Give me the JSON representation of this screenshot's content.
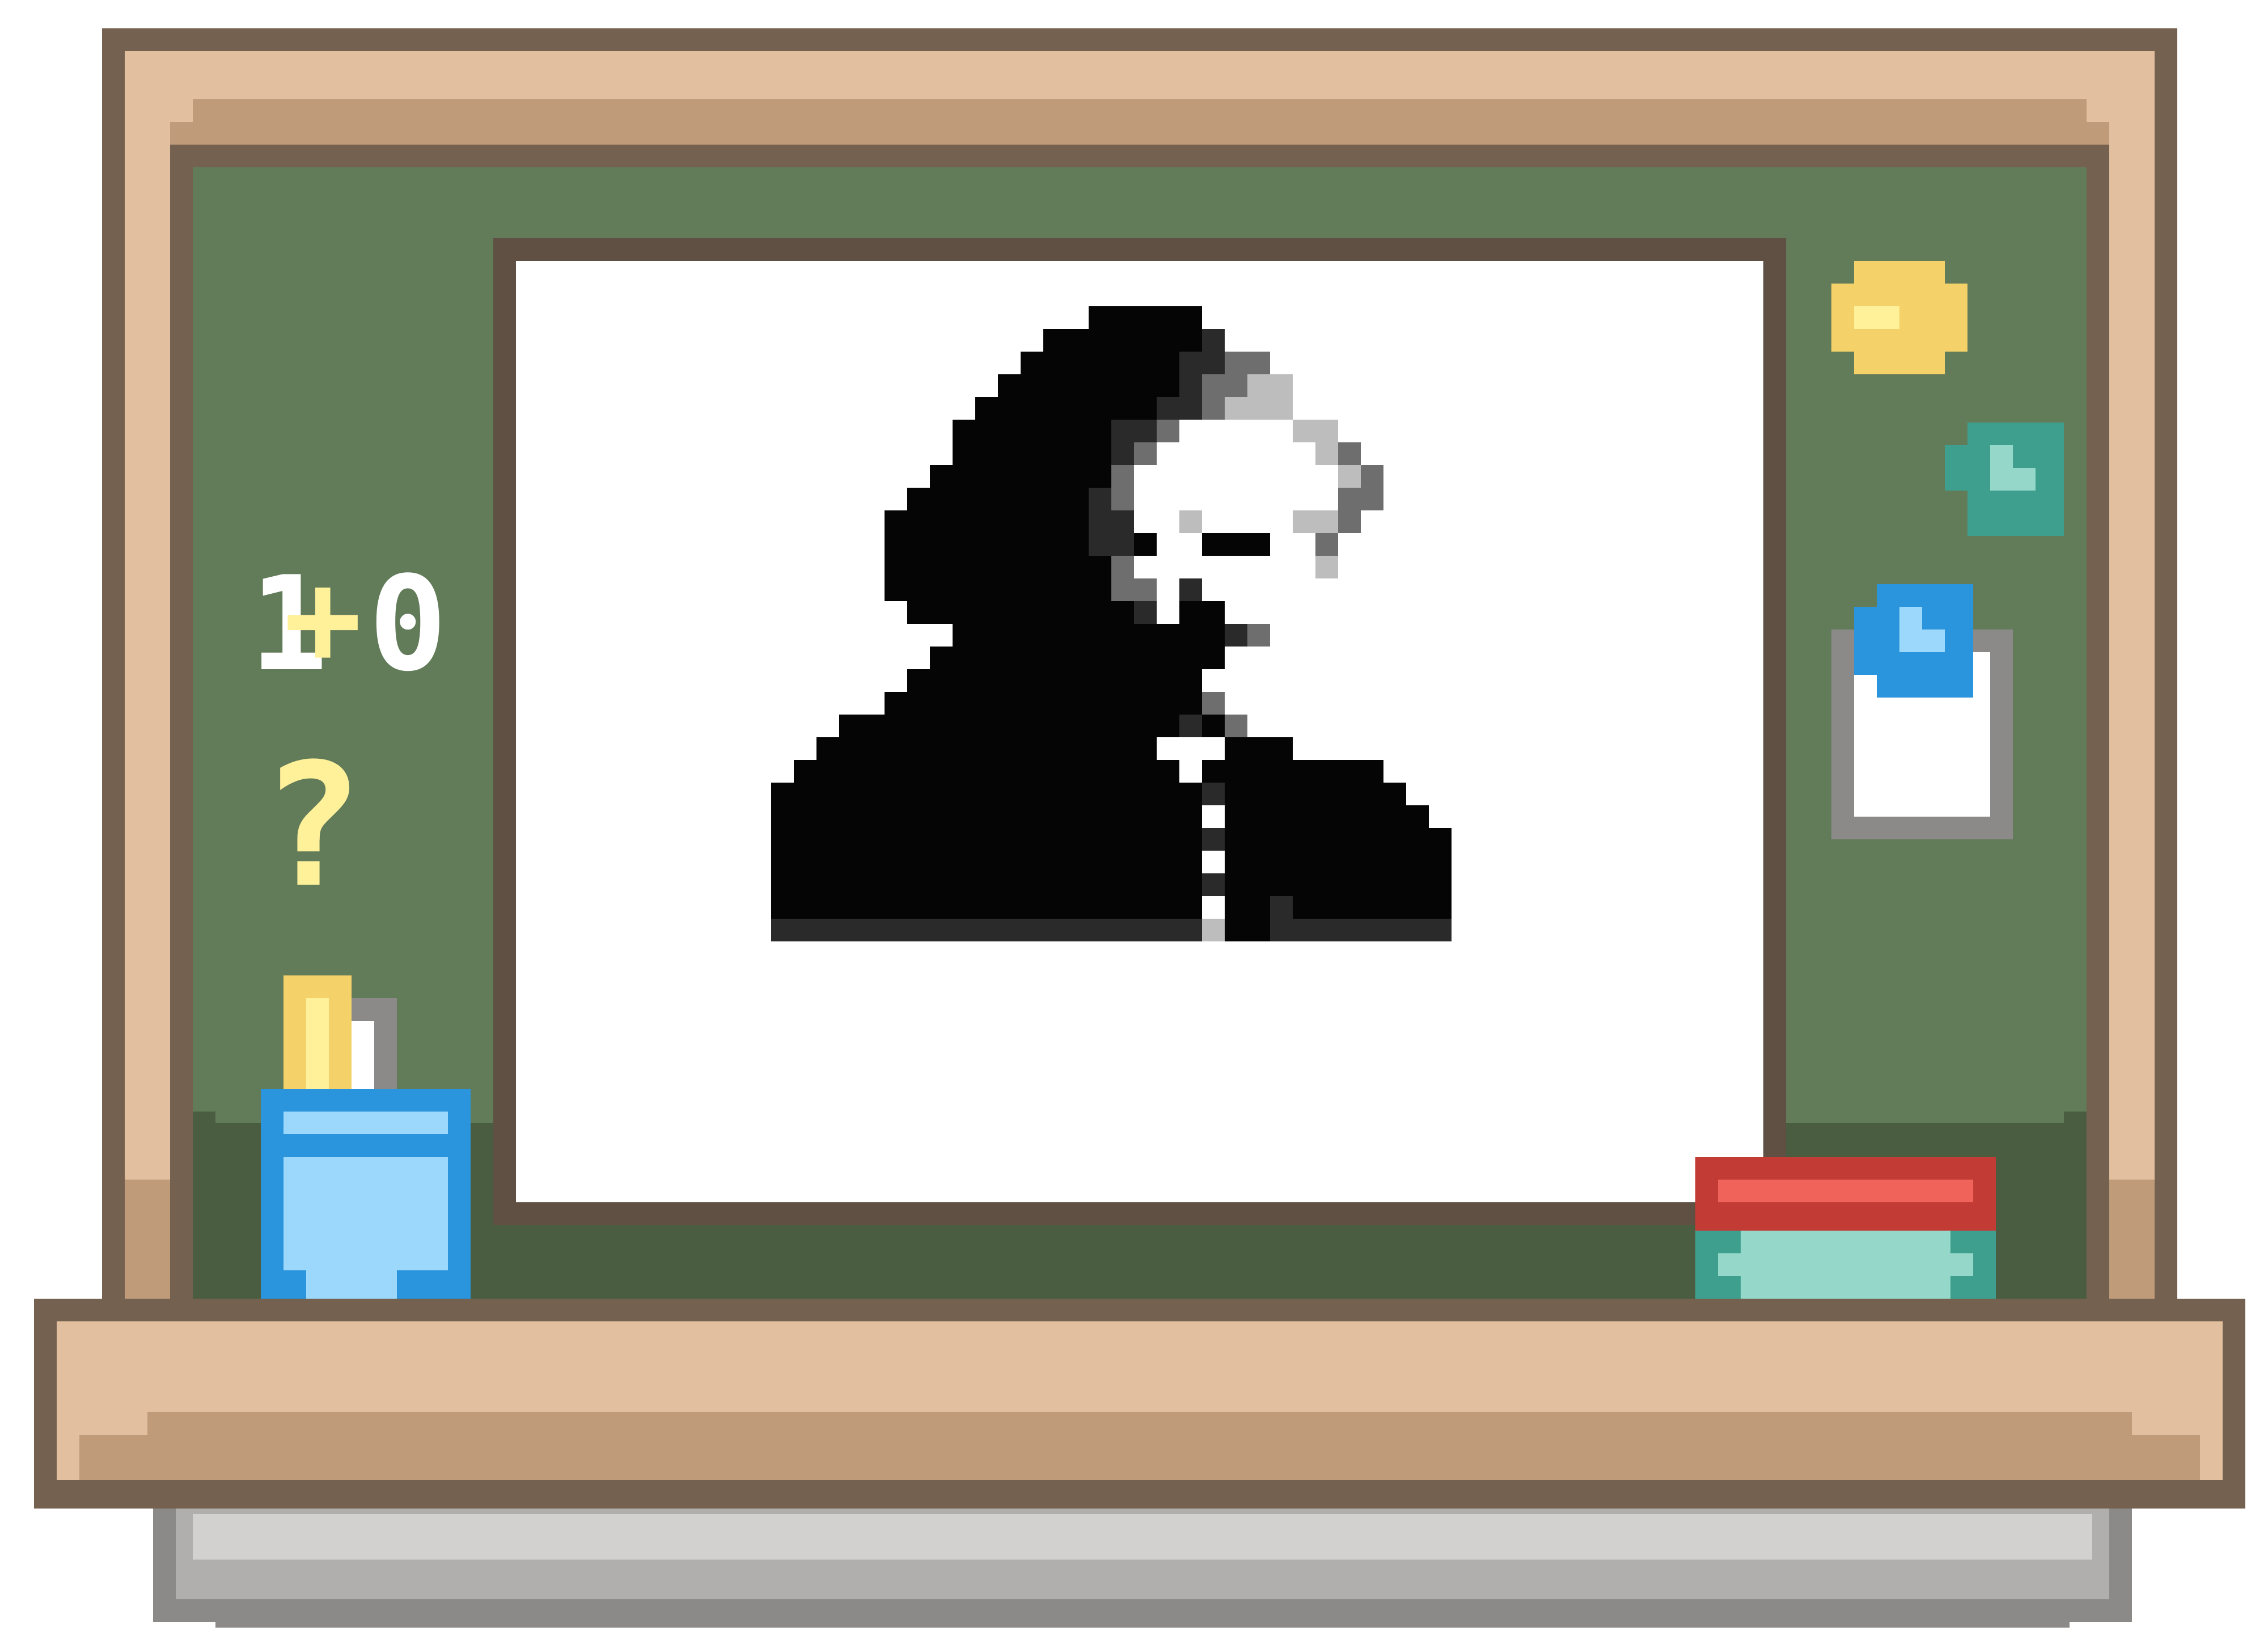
{
  "scene": {
    "chalk_equation": {
      "left": "1",
      "operator": "+",
      "right": "0"
    },
    "chalk_question": "?"
  },
  "colors": {
    "frame_light": "#e2c09f",
    "frame_mid": "#bf9b79",
    "frame_dark": "#75614f",
    "board_green": "#627c59",
    "board_shadow": "#4a5d40",
    "chalk_white": "#ffffff",
    "chalk_yellow": "#fff09a",
    "pin_yellow": "#f5d16a",
    "magnet_teal": "#3e9f8e",
    "pin_blue": "#2a94dc",
    "cup_blue": "#9bd8fb",
    "book_red": "#c23b34",
    "book_teal": "#95d7c8",
    "metal_light": "#d2d1cf",
    "metal_dark": "#8b8a88"
  },
  "icons": [
    "pushpin-icon",
    "magnet-icon",
    "sticky-note-icon",
    "chalk-holder-icon",
    "eraser-icon",
    "portrait-icon"
  ]
}
